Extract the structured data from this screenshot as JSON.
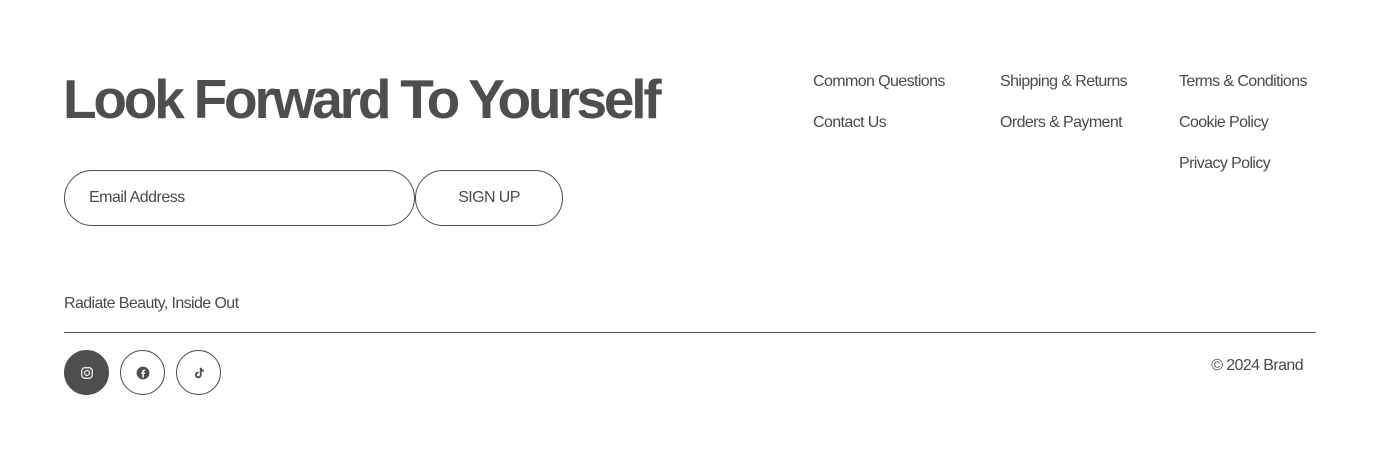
{
  "headline": "Look Forward To Yourself",
  "signup": {
    "email_placeholder": "Email Address",
    "button_label": "SIGN UP"
  },
  "links": {
    "column1": [
      "Common Questions",
      "Contact Us"
    ],
    "column2": [
      "Shipping & Returns",
      "Orders & Payment"
    ],
    "column3": [
      "Terms & Conditions",
      "Cookie Policy",
      "Privacy Policy"
    ]
  },
  "tagline": "Radiate Beauty, Inside Out",
  "social": [
    {
      "icon": "instagram-icon",
      "active": true
    },
    {
      "icon": "facebook-icon",
      "active": false
    },
    {
      "icon": "tiktok-icon",
      "active": false
    }
  ],
  "copyright": "© 2024 Brand",
  "colors": {
    "text": "#4a4a4a",
    "accent": "#4e4e4e",
    "background": "#ffffff"
  }
}
